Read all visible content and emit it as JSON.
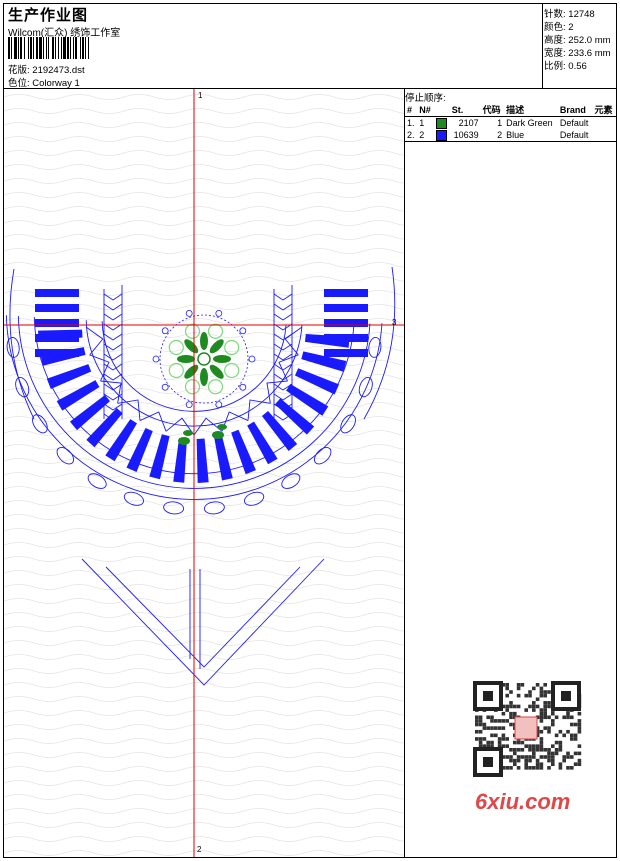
{
  "header": {
    "title": "生产作业图",
    "studio": "Wilcom(汇众) 绣饰工作室",
    "design_label": "花版:",
    "design_value": "2192473.dst",
    "colorway_label": "色位:",
    "colorway_value": "Colorway 1"
  },
  "specs": [
    {
      "label": "针数:",
      "value": "12748"
    },
    {
      "label": "颜色:",
      "value": "2"
    },
    {
      "label": "高度:",
      "value": "252.0 mm"
    },
    {
      "label": "宽度:",
      "value": "233.6 mm"
    },
    {
      "label": "比例:",
      "value": "0.56"
    }
  ],
  "stop_sequence": {
    "title": "停止顺序:",
    "columns": [
      "#",
      "N#",
      "St.",
      "代码",
      "描述",
      "Brand",
      "元素"
    ],
    "rows": [
      {
        "idx": "1.",
        "n": "1",
        "color": "#1f8a1f",
        "st": "2107",
        "code": "1",
        "desc": "Dark Green",
        "brand": "Default"
      },
      {
        "idx": "2.",
        "n": "2",
        "color": "#1a1aff",
        "st": "10639",
        "code": "2",
        "desc": "Blue",
        "brand": "Default"
      }
    ]
  },
  "markers": {
    "top": "1",
    "bottom": "2",
    "right": "3"
  },
  "watermark": "6xiu.com",
  "colors": {
    "blue": "#1a1aff",
    "green": "#1f8a1f",
    "light_green": "#7fd97f",
    "red": "#e00000"
  }
}
